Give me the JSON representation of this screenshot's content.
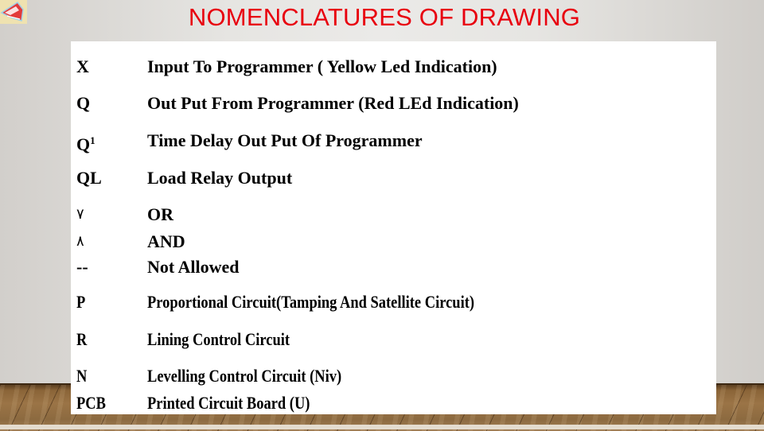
{
  "slide": {
    "title": "NOMENCLATURES OF DRAWING",
    "title_color": "#e8000e",
    "logo_icon": "train-icon"
  },
  "nomenclature": [
    {
      "symbol": "X",
      "symbol_sup": "",
      "description": "Input To Programmer ( Yellow Led Indication)"
    },
    {
      "symbol": "Q",
      "symbol_sup": "",
      "description": "Out Put From  Programmer (Red LEd Indication)"
    },
    {
      "symbol": "Q",
      "symbol_sup": "1",
      "description": "Time Delay  Out Put  Of Programmer"
    },
    {
      "symbol": "QL",
      "symbol_sup": "",
      "description": "Load Relay Output"
    },
    {
      "symbol": "٧",
      "symbol_sup": "",
      "description": "OR"
    },
    {
      "symbol": "٨",
      "symbol_sup": "",
      "description": "AND"
    },
    {
      "symbol": "--",
      "symbol_sup": "",
      "description": "Not Allowed"
    },
    {
      "symbol": "P",
      "symbol_sup": "",
      "description": "Proportional Circuit(Tamping And Satellite Circuit)"
    },
    {
      "symbol": "R",
      "symbol_sup": "",
      "description": "Lining Control Circuit"
    },
    {
      "symbol": "N",
      "symbol_sup": "",
      "description": "Levelling Control Circuit (Niv)"
    },
    {
      "symbol": "PCB",
      "symbol_sup": "",
      "description": "Printed Circuit Board (U)"
    }
  ]
}
